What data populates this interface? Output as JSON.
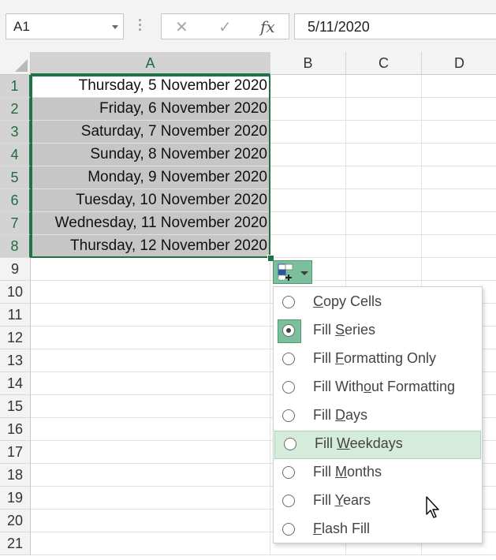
{
  "formula_bar": {
    "name_box": "A1",
    "cancel_glyph": "✕",
    "enter_glyph": "✓",
    "fx_glyph": "fx",
    "formula_value": "5/11/2020"
  },
  "columns": [
    "A",
    "B",
    "C",
    "D"
  ],
  "rows": [
    "1",
    "2",
    "3",
    "4",
    "5",
    "6",
    "7",
    "8",
    "9",
    "10",
    "11",
    "12",
    "13",
    "14",
    "15",
    "16",
    "17",
    "18",
    "19",
    "20",
    "21"
  ],
  "cells_A": [
    "Thursday, 5 November 2020",
    "Friday, 6 November 2020",
    "Saturday, 7 November 2020",
    "Sunday, 8 November 2020",
    "Monday, 9 November 2020",
    "Tuesday, 10 November 2020",
    "Wednesday, 11 November 2020",
    "Thursday, 12 November 2020"
  ],
  "autofill_menu": {
    "items": [
      {
        "pre": "",
        "acc": "C",
        "post": "opy Cells",
        "selected": false
      },
      {
        "pre": "Fill ",
        "acc": "S",
        "post": "eries",
        "selected": true
      },
      {
        "pre": "Fill ",
        "acc": "F",
        "post": "ormatting Only",
        "selected": false
      },
      {
        "pre": "Fill With",
        "acc": "o",
        "post": "ut Formatting",
        "selected": false
      },
      {
        "pre": "Fill ",
        "acc": "D",
        "post": "ays",
        "selected": false
      },
      {
        "pre": "Fill ",
        "acc": "W",
        "post": "eekdays",
        "selected": false
      },
      {
        "pre": "Fill ",
        "acc": "M",
        "post": "onths",
        "selected": false
      },
      {
        "pre": "Fill ",
        "acc": "Y",
        "post": "ears",
        "selected": false
      },
      {
        "pre": "",
        "acc": "F",
        "post": "lash Fill",
        "selected": false
      }
    ],
    "hovered_item": "Fill Weekdays"
  },
  "colors": {
    "accent_green": "#217346",
    "selection_gray": "#c6c6c6",
    "menu_highlight": "#d5ecdd",
    "button_green": "#7cbf9c"
  },
  "icons": [
    "name-box-dropdown-icon",
    "cancel-icon",
    "enter-icon",
    "function-icon",
    "autofill-options-icon",
    "mouse-pointer-icon"
  ]
}
